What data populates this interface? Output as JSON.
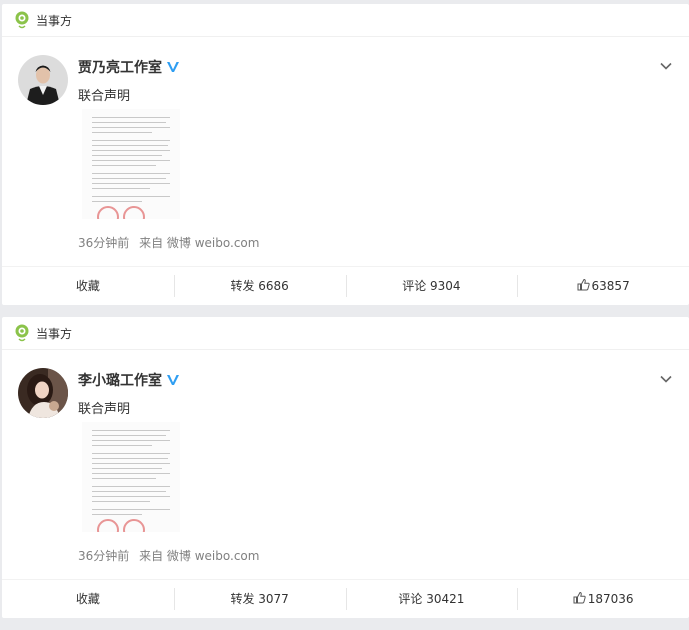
{
  "posts": [
    {
      "tag": "当事方",
      "name": "贾乃亮工作室",
      "text": "联合声明",
      "time": "36分钟前",
      "source": "来自 微博 weibo.com",
      "actions": {
        "collect": "收藏",
        "repost": "转发 6686",
        "comment": "评论 9304",
        "like": "63857"
      }
    },
    {
      "tag": "当事方",
      "name": "李小璐工作室",
      "text": "联合声明",
      "time": "36分钟前",
      "source": "来自 微博 weibo.com",
      "actions": {
        "collect": "收藏",
        "repost": "转发 3077",
        "comment": "评论 30421",
        "like": "187036"
      }
    }
  ],
  "colors": {
    "accent": "#8bc34a",
    "verified": "#2f9ef2",
    "meta": "#808080"
  }
}
